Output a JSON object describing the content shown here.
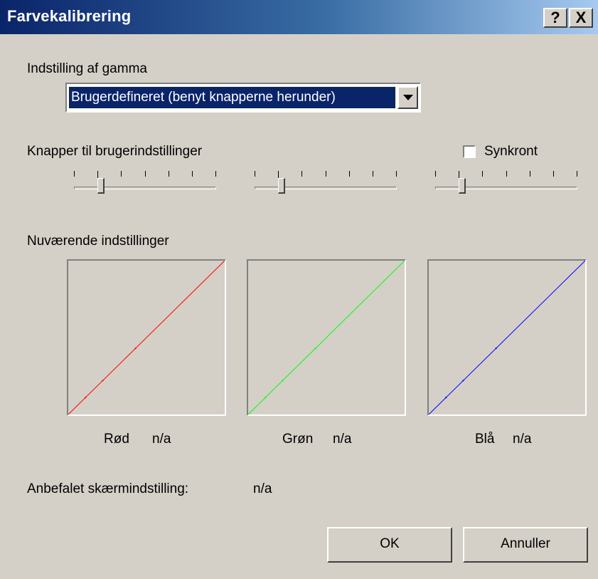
{
  "window": {
    "title": "Farvekalibrering",
    "help_label": "?",
    "close_label": "X"
  },
  "gamma": {
    "label": "Indstilling af gamma",
    "selected": "Brugerdefineret (benyt knapperne herunder)"
  },
  "user_controls": {
    "label": "Knapper til brugerindstillinger",
    "sync_label": "Synkront",
    "sync_checked": false,
    "sliders": [
      {
        "name": "red",
        "level": 0.19
      },
      {
        "name": "green",
        "level": 0.19
      },
      {
        "name": "blue",
        "level": 0.19
      }
    ]
  },
  "current": {
    "label": "Nuværende indstillinger",
    "channels": [
      {
        "name": "Rød",
        "value": "n/a",
        "color": "#ff0000"
      },
      {
        "name": "Grøn",
        "value": "n/a",
        "color": "#00ff00"
      },
      {
        "name": "Blå",
        "value": "n/a",
        "color": "#0000ff"
      }
    ]
  },
  "recommended": {
    "label": "Anbefalet skærmindstilling:",
    "value": "n/a"
  },
  "buttons": {
    "ok": "OK",
    "cancel": "Annuller"
  }
}
